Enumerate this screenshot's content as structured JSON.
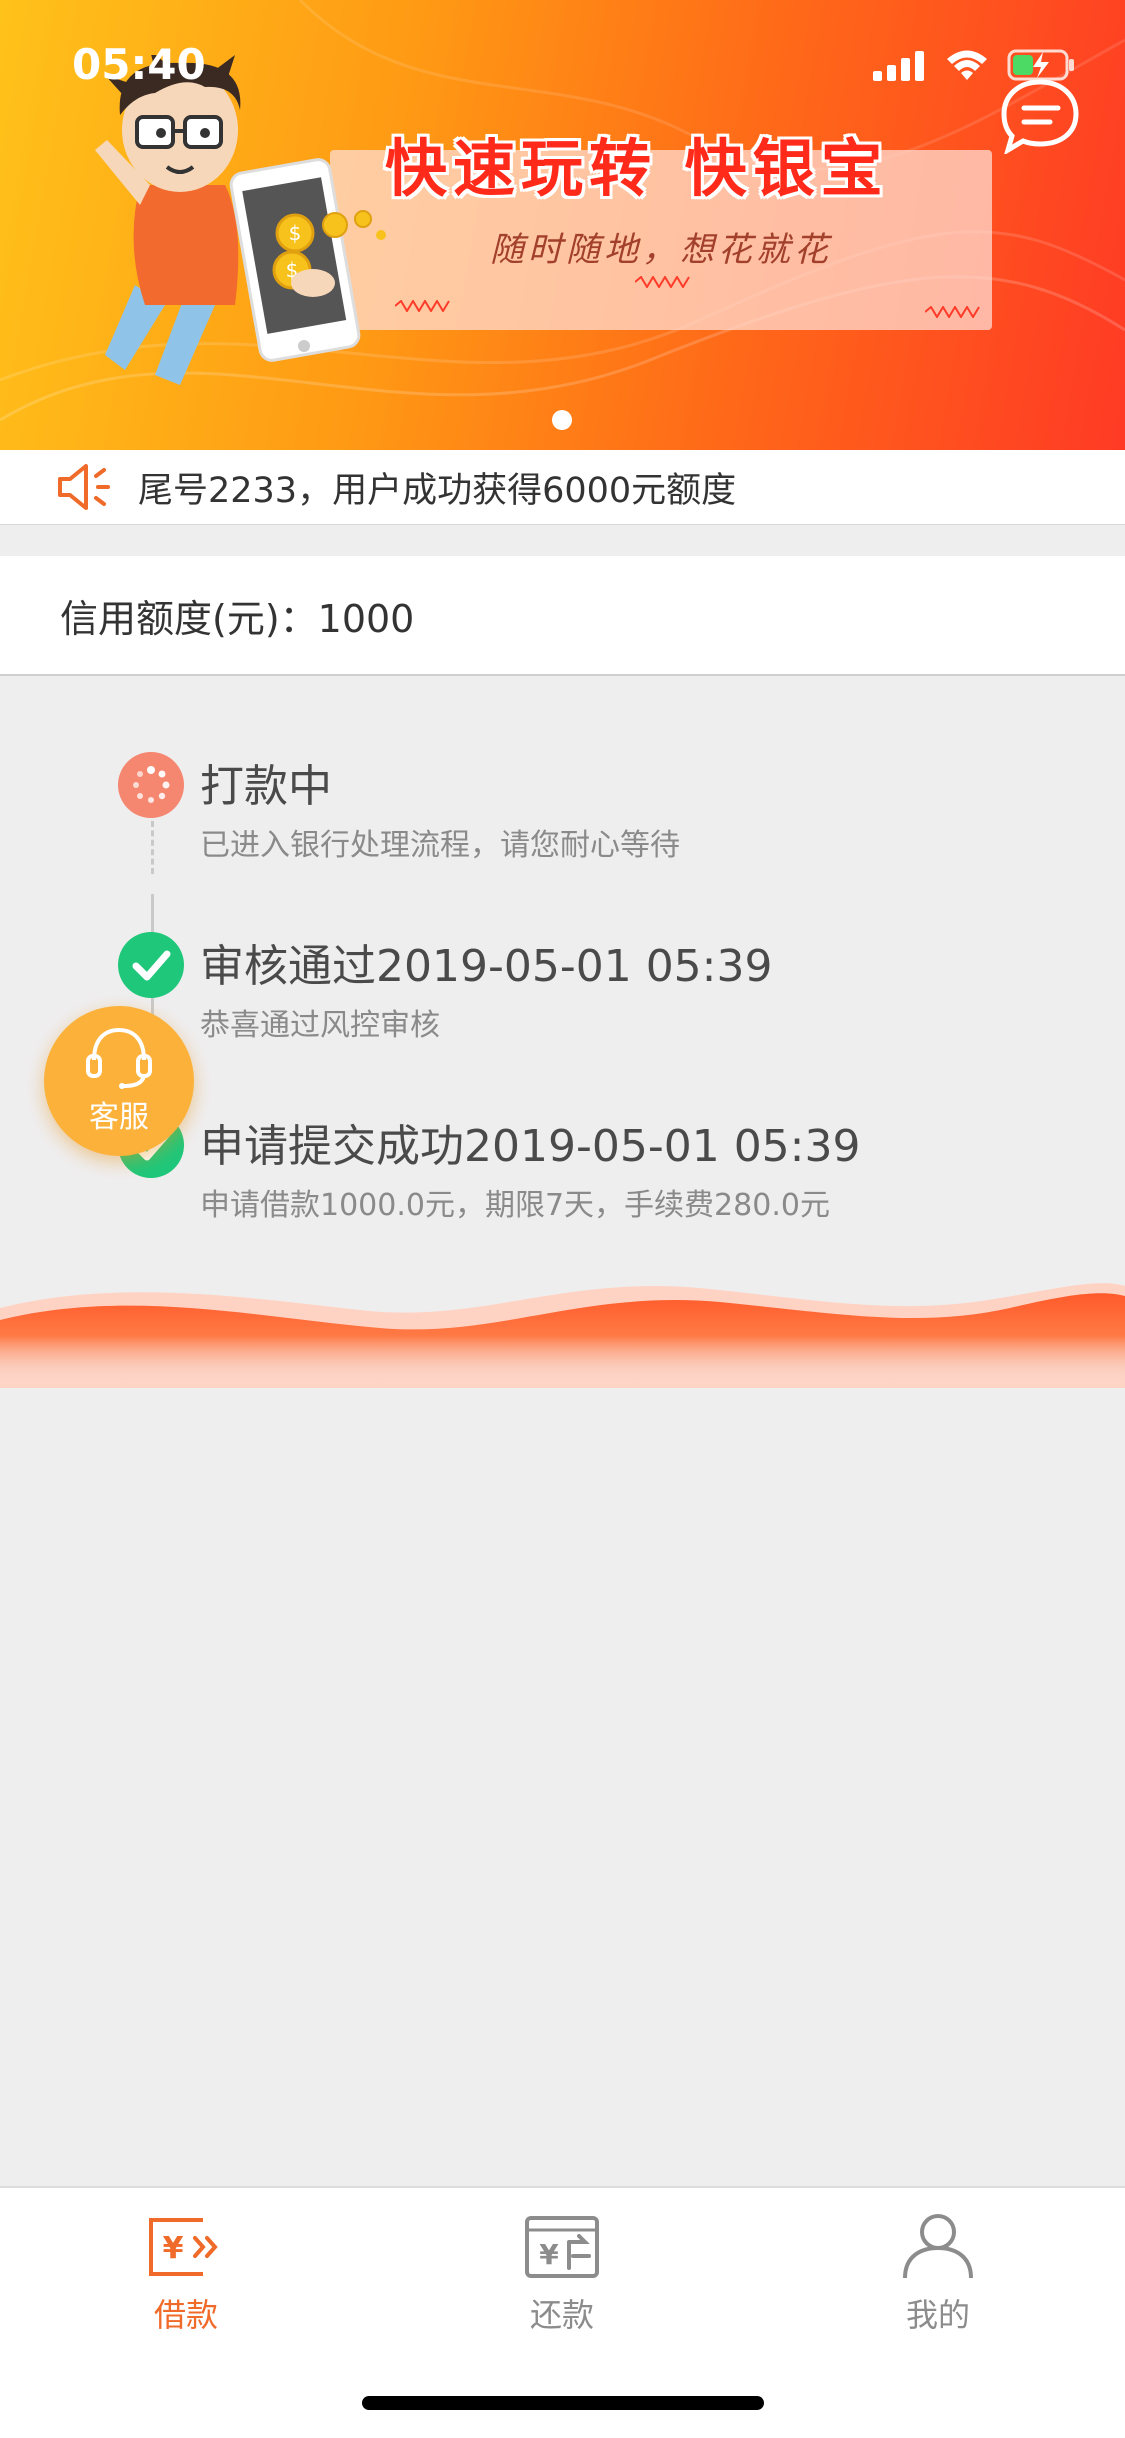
{
  "status_bar": {
    "time": "05:40"
  },
  "banner": {
    "title": "快速玩转 快银宝",
    "subtitle": "随时随地，想花就花",
    "coin_symbol": "$",
    "colors": {
      "start": "#ffc21a",
      "end": "#ff3a25",
      "title": "#ff2a1a"
    }
  },
  "notice": {
    "text": "尾号2233，用户成功获得6000元额度"
  },
  "credit": {
    "label": "信用额度(元)：1000"
  },
  "timeline": [
    {
      "title": "打款中",
      "desc": "已进入银行处理流程，请您耐心等待",
      "status": "processing"
    },
    {
      "title": "审核通过2019-05-01 05:39",
      "desc": "恭喜通过风控审核",
      "status": "done"
    },
    {
      "title": "申请提交成功2019-05-01 05:39",
      "desc": "申请借款1000.0元，期限7天，手续费280.0元",
      "status": "done"
    }
  ],
  "service": {
    "label": "客服"
  },
  "tabs": [
    {
      "label": "借款",
      "icon": "borrow-icon",
      "active": true
    },
    {
      "label": "还款",
      "icon": "repay-icon",
      "active": false
    },
    {
      "label": "我的",
      "icon": "profile-icon",
      "active": false
    }
  ],
  "colors": {
    "accent": "#f06a2a",
    "success": "#1fc77a",
    "processing": "#f58670",
    "service": "#fbb13a",
    "inactive": "#8c8c8c"
  }
}
